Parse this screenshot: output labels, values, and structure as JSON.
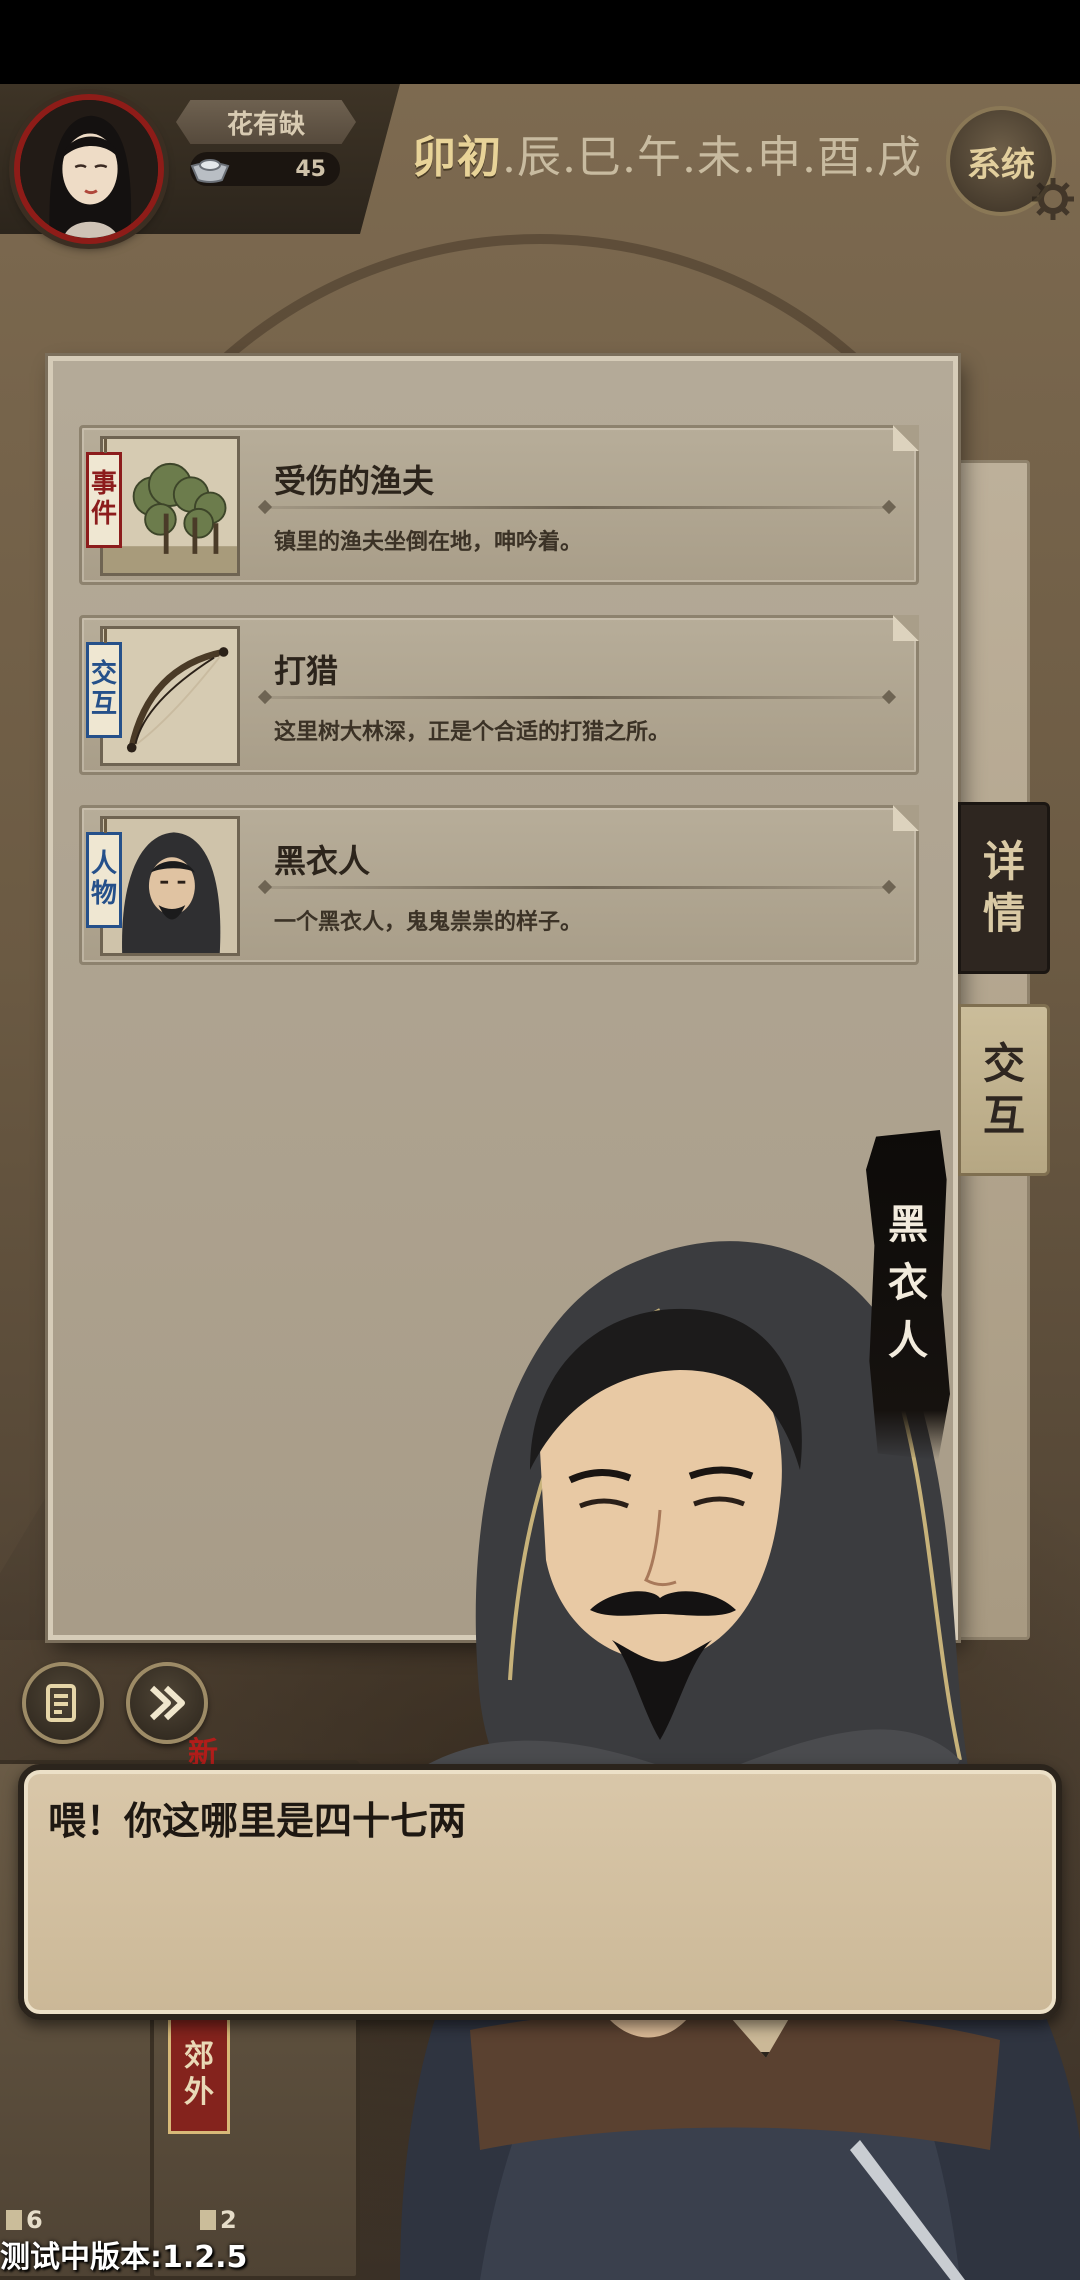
{
  "player": {
    "name": "花有缺",
    "silver": "45"
  },
  "time_periods": [
    "卯初",
    ".辰",
    ".巳",
    ".午",
    ".未",
    ".申",
    ".酉",
    ".戌"
  ],
  "system_button_label": "系统",
  "cards": [
    {
      "tag": [
        "事",
        "件"
      ],
      "tag_color": "#8c1c1c",
      "title": "受伤的渔夫",
      "description": "镇里的渔夫坐倒在地，呻吟着。",
      "image": "forest-icon"
    },
    {
      "tag": [
        "交",
        "互"
      ],
      "tag_color": "#25508a",
      "title": "打猎",
      "description": "这里树大林深，正是个合适的打猎之所。",
      "image": "bow-icon"
    },
    {
      "tag": [
        "人",
        "物"
      ],
      "tag_color": "#25508a",
      "title": "黑衣人",
      "description": "一个黑衣人，鬼鬼祟祟的样子。",
      "image": "hooded-man-portrait"
    }
  ],
  "side_tabs": {
    "details": [
      "详",
      "情"
    ],
    "interact": [
      "交",
      "互"
    ]
  },
  "speaker_name": [
    "黑",
    "衣",
    "人"
  ],
  "dialog_text": "喂！你这哪里是四十七两",
  "new_label": "新",
  "bottom": {
    "location_sign": [
      "郊",
      "外"
    ],
    "count_left": "6",
    "count_right": "2"
  },
  "version_text": "测试中版本:1.2.5"
}
